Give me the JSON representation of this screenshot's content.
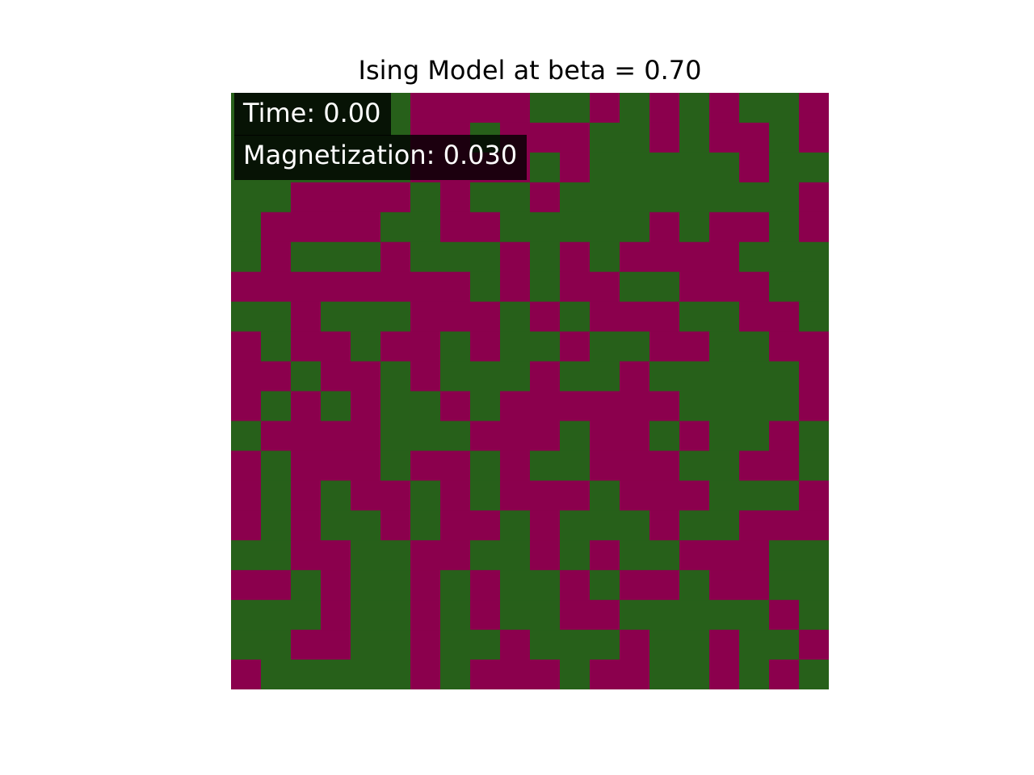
{
  "chart_data": {
    "type": "heatmap",
    "title": "Ising Model at beta = 0.70",
    "annotations": {
      "time_label": "Time: 0.00",
      "magnetization_label": "Magnetization: 0.030"
    },
    "grid_rows": 20,
    "grid_cols": 20,
    "color_map": {
      "1": "#8b004d",
      "-1": "#27601a"
    },
    "cells": [
      [
        -1,
        -1,
        -1,
        -1,
        -1,
        -1,
        1,
        1,
        1,
        1,
        -1,
        -1,
        1,
        -1,
        1,
        -1,
        1,
        -1,
        -1,
        1
      ],
      [
        -1,
        -1,
        -1,
        -1,
        -1,
        -1,
        1,
        1,
        -1,
        1,
        1,
        1,
        -1,
        -1,
        1,
        -1,
        1,
        1,
        -1,
        1
      ],
      [
        -1,
        -1,
        -1,
        -1,
        -1,
        -1,
        1,
        1,
        1,
        1,
        -1,
        1,
        -1,
        -1,
        -1,
        -1,
        -1,
        1,
        -1,
        -1
      ],
      [
        -1,
        -1,
        1,
        1,
        1,
        1,
        -1,
        1,
        -1,
        -1,
        1,
        -1,
        -1,
        -1,
        -1,
        -1,
        -1,
        -1,
        -1,
        1
      ],
      [
        -1,
        1,
        1,
        1,
        1,
        -1,
        -1,
        1,
        1,
        -1,
        -1,
        -1,
        -1,
        -1,
        1,
        -1,
        1,
        1,
        -1,
        1
      ],
      [
        -1,
        1,
        -1,
        -1,
        -1,
        1,
        -1,
        -1,
        -1,
        1,
        -1,
        1,
        -1,
        1,
        1,
        1,
        1,
        -1,
        -1,
        -1
      ],
      [
        1,
        1,
        1,
        1,
        1,
        1,
        1,
        1,
        -1,
        1,
        -1,
        1,
        1,
        -1,
        -1,
        1,
        1,
        1,
        -1,
        -1
      ],
      [
        -1,
        -1,
        1,
        -1,
        -1,
        -1,
        1,
        1,
        1,
        -1,
        1,
        -1,
        1,
        1,
        1,
        -1,
        -1,
        1,
        1,
        -1
      ],
      [
        1,
        -1,
        1,
        1,
        -1,
        1,
        1,
        -1,
        1,
        -1,
        -1,
        1,
        -1,
        -1,
        1,
        1,
        -1,
        -1,
        1,
        1
      ],
      [
        1,
        1,
        -1,
        1,
        1,
        -1,
        1,
        -1,
        -1,
        -1,
        1,
        -1,
        -1,
        1,
        -1,
        -1,
        -1,
        -1,
        -1,
        1
      ],
      [
        1,
        -1,
        1,
        -1,
        1,
        -1,
        -1,
        1,
        -1,
        1,
        1,
        1,
        1,
        1,
        1,
        -1,
        -1,
        -1,
        -1,
        1
      ],
      [
        -1,
        1,
        1,
        1,
        1,
        -1,
        -1,
        -1,
        1,
        1,
        1,
        -1,
        1,
        1,
        -1,
        1,
        -1,
        -1,
        1,
        -1
      ],
      [
        1,
        -1,
        1,
        1,
        1,
        -1,
        1,
        1,
        -1,
        1,
        -1,
        -1,
        1,
        1,
        1,
        -1,
        -1,
        1,
        1,
        -1
      ],
      [
        1,
        -1,
        1,
        -1,
        1,
        1,
        -1,
        1,
        -1,
        1,
        1,
        1,
        -1,
        1,
        1,
        1,
        -1,
        -1,
        -1,
        1
      ],
      [
        1,
        -1,
        1,
        -1,
        -1,
        1,
        -1,
        1,
        1,
        -1,
        1,
        -1,
        -1,
        -1,
        1,
        -1,
        -1,
        1,
        1,
        1
      ],
      [
        -1,
        -1,
        1,
        1,
        -1,
        -1,
        1,
        1,
        -1,
        -1,
        1,
        -1,
        1,
        -1,
        -1,
        1,
        1,
        1,
        -1,
        -1
      ],
      [
        1,
        1,
        -1,
        1,
        -1,
        -1,
        1,
        -1,
        1,
        -1,
        -1,
        1,
        -1,
        1,
        1,
        -1,
        1,
        1,
        -1,
        -1
      ],
      [
        -1,
        -1,
        -1,
        1,
        -1,
        -1,
        1,
        -1,
        1,
        -1,
        -1,
        1,
        1,
        -1,
        -1,
        -1,
        -1,
        -1,
        1,
        -1
      ],
      [
        -1,
        -1,
        1,
        1,
        -1,
        -1,
        1,
        -1,
        -1,
        1,
        -1,
        -1,
        -1,
        1,
        -1,
        -1,
        1,
        -1,
        -1,
        1
      ],
      [
        1,
        -1,
        -1,
        -1,
        -1,
        -1,
        1,
        -1,
        1,
        1,
        1,
        -1,
        1,
        1,
        -1,
        -1,
        1,
        -1,
        1,
        -1
      ]
    ]
  }
}
